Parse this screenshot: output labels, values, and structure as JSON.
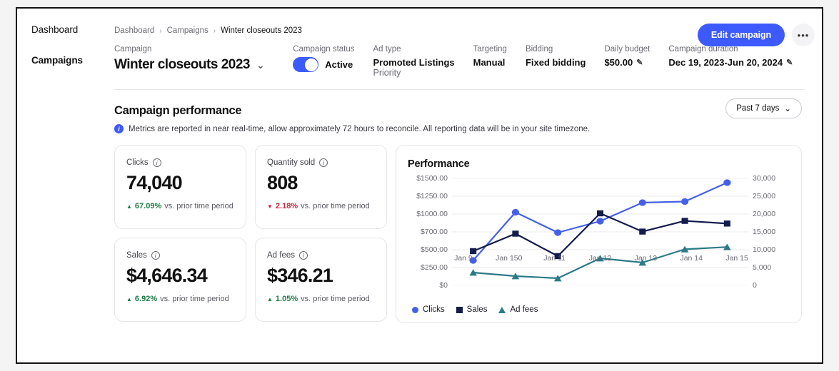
{
  "sidebar": {
    "items": [
      {
        "label": "Dashboard",
        "active": false
      },
      {
        "label": "Campaigns",
        "active": true
      }
    ]
  },
  "breadcrumb": {
    "items": [
      "Dashboard",
      "Campaigns",
      "Winter closeouts 2023"
    ],
    "separator": "›"
  },
  "header": {
    "edit_label": "Edit campaign",
    "more_label": "•••"
  },
  "summary": {
    "campaign": {
      "label": "Campaign",
      "value": "Winter closeouts 2023",
      "chevron": "⌄"
    },
    "status": {
      "label": "Campaign status",
      "value": "Active",
      "toggle_on": true
    },
    "ad_type": {
      "label": "Ad type",
      "value": "Promoted Listings",
      "sub": "Priority"
    },
    "targeting": {
      "label": "Targeting",
      "value": "Manual"
    },
    "bidding": {
      "label": "Bidding",
      "value": "Fixed bidding"
    },
    "daily_budget": {
      "label": "Daily budget",
      "value": "$50.00",
      "edit_icon": "✎"
    },
    "duration": {
      "label": "Campaign duration",
      "value": "Dec 19, 2023-Jun 20, 2024",
      "edit_icon": "✎"
    }
  },
  "performance": {
    "title": "Campaign performance",
    "note": "Metrics are reported in near real-time, allow approximately 72 hours to reconcile. All reporting data will be in your site timezone.",
    "info_glyph": "i",
    "range": {
      "label": "Past 7 days",
      "chevron": "⌄"
    }
  },
  "metrics": [
    {
      "label": "Clicks",
      "value": "74,040",
      "delta": "67.09%",
      "direction": "up",
      "arrow": "▲",
      "caption": "vs. prior time period"
    },
    {
      "label": "Quantity sold",
      "value": "808",
      "delta": "2.18%",
      "direction": "down",
      "arrow": "▼",
      "caption": "vs. prior time period"
    },
    {
      "label": "Sales",
      "value": "$4,646.34",
      "delta": "6.92%",
      "direction": "up",
      "arrow": "▲",
      "caption": "vs. prior time period"
    },
    {
      "label": "Ad fees",
      "value": "$346.21",
      "delta": "1.05%",
      "direction": "up",
      "arrow": "▲",
      "caption": "vs. prior time period"
    }
  ],
  "chart_data": {
    "type": "line",
    "title": "Performance",
    "xlabel": "",
    "ylabel": "",
    "grid": true,
    "legend_position": "bottom-left",
    "categories": [
      "Jan 9",
      "Jan 150",
      "Jan 11",
      "Jan 12",
      "Jan 13",
      "Jan 14",
      "Jan 15"
    ],
    "left_axis": {
      "ticks": [
        "$0",
        "$250.00",
        "$500.00",
        "$700.00",
        "$1000.00",
        "$1250.00",
        "$1500.00"
      ],
      "values": [
        0,
        250,
        500,
        700,
        1000,
        1250,
        1500
      ],
      "ylim": [
        0,
        1500
      ]
    },
    "right_axis": {
      "ticks": [
        "0",
        "5,000",
        "10,000",
        "15,000",
        "20,000",
        "25,000",
        "30,000"
      ],
      "values": [
        0,
        5000,
        10000,
        15000,
        20000,
        25000,
        30000
      ],
      "ylim": [
        0,
        30000
      ]
    },
    "series": [
      {
        "name": "Clicks",
        "axis": "right",
        "marker": "circle",
        "color": "#4560e6",
        "values": [
          7000,
          20500,
          14800,
          18000,
          23200,
          23500,
          28800
        ]
      },
      {
        "name": "Sales",
        "axis": "left",
        "marker": "square",
        "color": "#141b4d",
        "values": [
          480,
          680,
          410,
          1010,
          705,
          885,
          840
        ]
      },
      {
        "name": "Ad fees",
        "axis": "left",
        "marker": "triangle",
        "color": "#2b7a86",
        "values": [
          180,
          130,
          100,
          380,
          320,
          505,
          530
        ]
      }
    ]
  },
  "colors": {
    "accent": "#3d5afe",
    "clicks": "#4560e6",
    "sales": "#141b4d",
    "adfees": "#2b7a86",
    "positive": "#1c7c46",
    "negative": "#c9253c"
  }
}
